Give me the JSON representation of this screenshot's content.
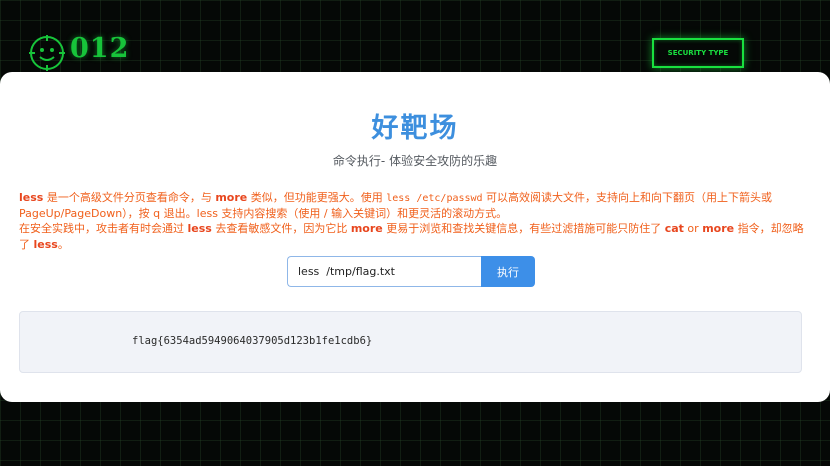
{
  "header": {
    "logo_text": "012",
    "security_button_label": "SECURITY TYPE"
  },
  "card": {
    "title": "好靶场",
    "subtitle": "命令执行- 体验安全攻防的乐趣",
    "description": {
      "p1": {
        "kw_less": "less",
        "t1": " 是一个高级文件分页查看命令，与 ",
        "kw_more": "more",
        "t2": " 类似，但功能更强大。使用 ",
        "code": "less /etc/passwd",
        "t3": " 可以高效阅读大文件，支持向上和向下翻页（用上下箭头或 PageUp/PageDown），按 q 退出。less 支持内容搜索（使用 / 输入关键词）和更灵活的滚动方式。"
      },
      "p2": {
        "t1": "在安全实践中，攻击者有时会通过 ",
        "kw_less": "less",
        "t2": " 去查看敏感文件，因为它比 ",
        "kw_more": "more",
        "t3": " 更易于浏览和查找关键信息，有些过滤措施可能只防住了 ",
        "kw_cat": "cat",
        "t4": " or ",
        "kw_more2": "more",
        "t5": " 指令，却忽略了 ",
        "kw_less2": "less",
        "t6": "。"
      }
    },
    "command_input": {
      "value": "less  /tmp/flag.txt"
    },
    "execute_button_label": "执行",
    "result_text": "flag{6354ad5949064037905d123b1fe1cdb6}"
  },
  "colors": {
    "accent_blue": "#3d8fde",
    "warning_orange": "#f0601c",
    "neon_green": "#19e03f"
  },
  "icons": {
    "logo": "smiley-crosshair-icon"
  }
}
